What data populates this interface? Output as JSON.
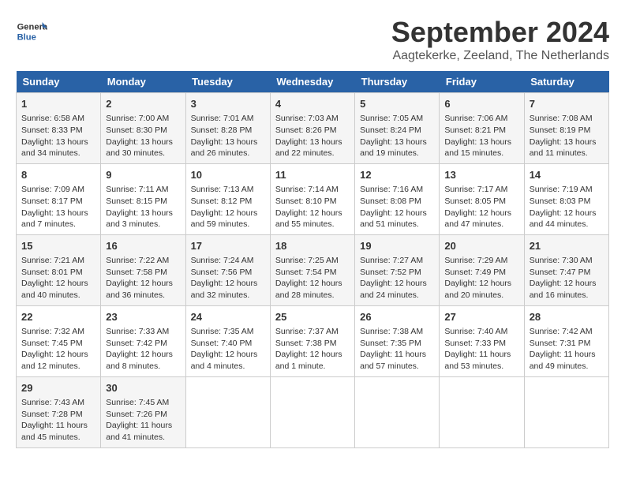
{
  "header": {
    "logo_line1": "General",
    "logo_line2": "Blue",
    "title": "September 2024",
    "subtitle": "Aagtekerke, Zeeland, The Netherlands"
  },
  "calendar": {
    "days_of_week": [
      "Sunday",
      "Monday",
      "Tuesday",
      "Wednesday",
      "Thursday",
      "Friday",
      "Saturday"
    ],
    "weeks": [
      [
        {
          "day": "1",
          "info": "Sunrise: 6:58 AM\nSunset: 8:33 PM\nDaylight: 13 hours\nand 34 minutes."
        },
        {
          "day": "2",
          "info": "Sunrise: 7:00 AM\nSunset: 8:30 PM\nDaylight: 13 hours\nand 30 minutes."
        },
        {
          "day": "3",
          "info": "Sunrise: 7:01 AM\nSunset: 8:28 PM\nDaylight: 13 hours\nand 26 minutes."
        },
        {
          "day": "4",
          "info": "Sunrise: 7:03 AM\nSunset: 8:26 PM\nDaylight: 13 hours\nand 22 minutes."
        },
        {
          "day": "5",
          "info": "Sunrise: 7:05 AM\nSunset: 8:24 PM\nDaylight: 13 hours\nand 19 minutes."
        },
        {
          "day": "6",
          "info": "Sunrise: 7:06 AM\nSunset: 8:21 PM\nDaylight: 13 hours\nand 15 minutes."
        },
        {
          "day": "7",
          "info": "Sunrise: 7:08 AM\nSunset: 8:19 PM\nDaylight: 13 hours\nand 11 minutes."
        }
      ],
      [
        {
          "day": "8",
          "info": "Sunrise: 7:09 AM\nSunset: 8:17 PM\nDaylight: 13 hours\nand 7 minutes."
        },
        {
          "day": "9",
          "info": "Sunrise: 7:11 AM\nSunset: 8:15 PM\nDaylight: 13 hours\nand 3 minutes."
        },
        {
          "day": "10",
          "info": "Sunrise: 7:13 AM\nSunset: 8:12 PM\nDaylight: 12 hours\nand 59 minutes."
        },
        {
          "day": "11",
          "info": "Sunrise: 7:14 AM\nSunset: 8:10 PM\nDaylight: 12 hours\nand 55 minutes."
        },
        {
          "day": "12",
          "info": "Sunrise: 7:16 AM\nSunset: 8:08 PM\nDaylight: 12 hours\nand 51 minutes."
        },
        {
          "day": "13",
          "info": "Sunrise: 7:17 AM\nSunset: 8:05 PM\nDaylight: 12 hours\nand 47 minutes."
        },
        {
          "day": "14",
          "info": "Sunrise: 7:19 AM\nSunset: 8:03 PM\nDaylight: 12 hours\nand 44 minutes."
        }
      ],
      [
        {
          "day": "15",
          "info": "Sunrise: 7:21 AM\nSunset: 8:01 PM\nDaylight: 12 hours\nand 40 minutes."
        },
        {
          "day": "16",
          "info": "Sunrise: 7:22 AM\nSunset: 7:58 PM\nDaylight: 12 hours\nand 36 minutes."
        },
        {
          "day": "17",
          "info": "Sunrise: 7:24 AM\nSunset: 7:56 PM\nDaylight: 12 hours\nand 32 minutes."
        },
        {
          "day": "18",
          "info": "Sunrise: 7:25 AM\nSunset: 7:54 PM\nDaylight: 12 hours\nand 28 minutes."
        },
        {
          "day": "19",
          "info": "Sunrise: 7:27 AM\nSunset: 7:52 PM\nDaylight: 12 hours\nand 24 minutes."
        },
        {
          "day": "20",
          "info": "Sunrise: 7:29 AM\nSunset: 7:49 PM\nDaylight: 12 hours\nand 20 minutes."
        },
        {
          "day": "21",
          "info": "Sunrise: 7:30 AM\nSunset: 7:47 PM\nDaylight: 12 hours\nand 16 minutes."
        }
      ],
      [
        {
          "day": "22",
          "info": "Sunrise: 7:32 AM\nSunset: 7:45 PM\nDaylight: 12 hours\nand 12 minutes."
        },
        {
          "day": "23",
          "info": "Sunrise: 7:33 AM\nSunset: 7:42 PM\nDaylight: 12 hours\nand 8 minutes."
        },
        {
          "day": "24",
          "info": "Sunrise: 7:35 AM\nSunset: 7:40 PM\nDaylight: 12 hours\nand 4 minutes."
        },
        {
          "day": "25",
          "info": "Sunrise: 7:37 AM\nSunset: 7:38 PM\nDaylight: 12 hours\nand 1 minute."
        },
        {
          "day": "26",
          "info": "Sunrise: 7:38 AM\nSunset: 7:35 PM\nDaylight: 11 hours\nand 57 minutes."
        },
        {
          "day": "27",
          "info": "Sunrise: 7:40 AM\nSunset: 7:33 PM\nDaylight: 11 hours\nand 53 minutes."
        },
        {
          "day": "28",
          "info": "Sunrise: 7:42 AM\nSunset: 7:31 PM\nDaylight: 11 hours\nand 49 minutes."
        }
      ],
      [
        {
          "day": "29",
          "info": "Sunrise: 7:43 AM\nSunset: 7:28 PM\nDaylight: 11 hours\nand 45 minutes."
        },
        {
          "day": "30",
          "info": "Sunrise: 7:45 AM\nSunset: 7:26 PM\nDaylight: 11 hours\nand 41 minutes."
        },
        {
          "day": "",
          "info": ""
        },
        {
          "day": "",
          "info": ""
        },
        {
          "day": "",
          "info": ""
        },
        {
          "day": "",
          "info": ""
        },
        {
          "day": "",
          "info": ""
        }
      ]
    ]
  }
}
